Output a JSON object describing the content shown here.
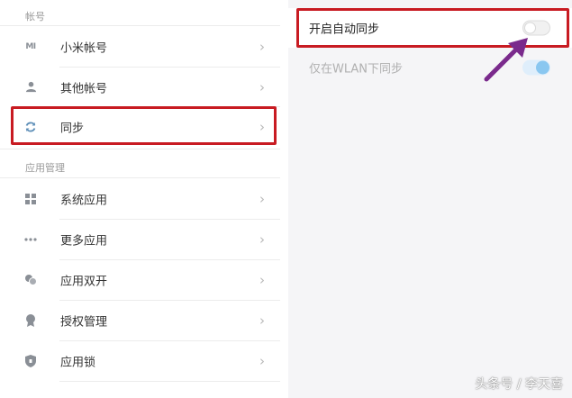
{
  "left_panel": {
    "section_account": "帐号",
    "account_items": [
      {
        "label": "小米帐号",
        "icon": "mi-logo-icon"
      },
      {
        "label": "其他帐号",
        "icon": "person-icon"
      },
      {
        "label": "同步",
        "icon": "sync-icon"
      }
    ],
    "section_apps": "应用管理",
    "app_items": [
      {
        "label": "系统应用",
        "icon": "grid-icon"
      },
      {
        "label": "更多应用",
        "icon": "more-dots-icon"
      },
      {
        "label": "应用双开",
        "icon": "dual-app-icon"
      },
      {
        "label": "授权管理",
        "icon": "badge-icon"
      },
      {
        "label": "应用锁",
        "icon": "shield-lock-icon"
      }
    ],
    "mi_logo_text": "MI"
  },
  "right_panel": {
    "auto_sync": {
      "label": "开启自动同步",
      "enabled": false
    },
    "wifi_only": {
      "label": "仅在WLAN下同步",
      "enabled": true
    }
  },
  "annotations": {
    "highlight_color": "#c81b22",
    "arrow_color": "#7a2a8c"
  },
  "watermark": "头条号 / 李天喜",
  "colors": {
    "toggle_on": "#8ac7f0",
    "chevron": "#b8b8b8",
    "icon": "#8a8f96"
  }
}
